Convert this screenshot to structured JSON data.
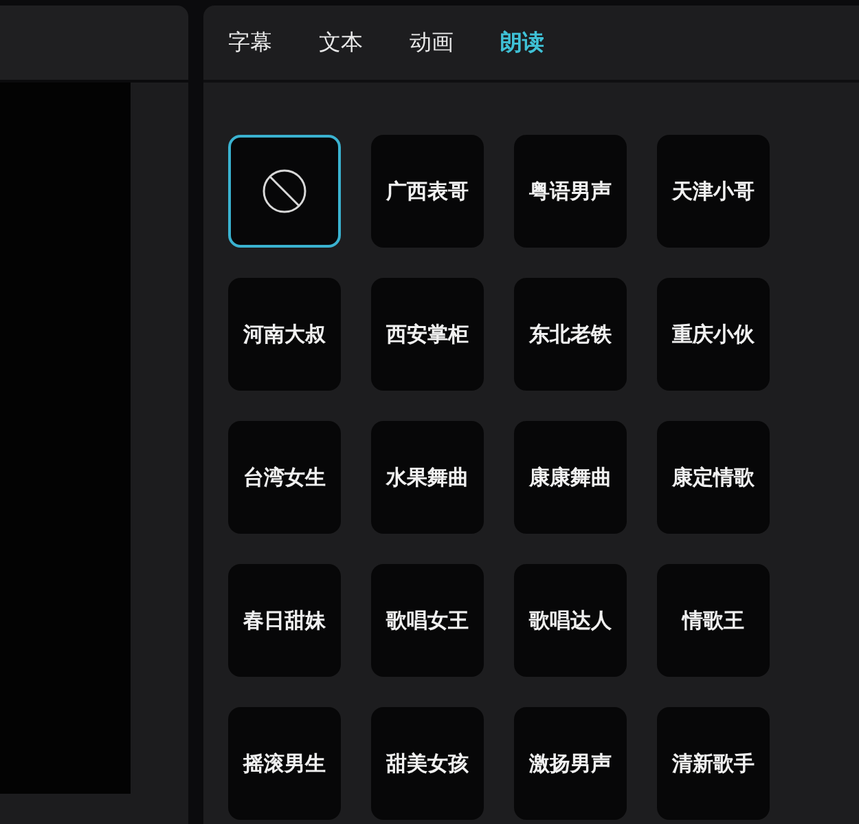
{
  "tabs": [
    {
      "label": "字幕",
      "selected": false
    },
    {
      "label": "文本",
      "selected": false
    },
    {
      "label": "动画",
      "selected": false
    },
    {
      "label": "朗读",
      "selected": true
    }
  ],
  "voices": [
    {
      "kind": "none",
      "selected": true
    },
    {
      "kind": "voice",
      "label": "广西表哥",
      "selected": false
    },
    {
      "kind": "voice",
      "label": "粤语男声",
      "selected": false
    },
    {
      "kind": "voice",
      "label": "天津小哥",
      "selected": false
    },
    {
      "kind": "voice",
      "label": "河南大叔",
      "selected": false
    },
    {
      "kind": "voice",
      "label": "西安掌柜",
      "selected": false
    },
    {
      "kind": "voice",
      "label": "东北老铁",
      "selected": false
    },
    {
      "kind": "voice",
      "label": "重庆小伙",
      "selected": false
    },
    {
      "kind": "voice",
      "label": "台湾女生",
      "selected": false
    },
    {
      "kind": "voice",
      "label": "水果舞曲",
      "selected": false
    },
    {
      "kind": "voice",
      "label": "康康舞曲",
      "selected": false
    },
    {
      "kind": "voice",
      "label": "康定情歌",
      "selected": false
    },
    {
      "kind": "voice",
      "label": "春日甜妹",
      "selected": false
    },
    {
      "kind": "voice",
      "label": "歌唱女王",
      "selected": false
    },
    {
      "kind": "voice",
      "label": "歌唱达人",
      "selected": false
    },
    {
      "kind": "voice",
      "label": "情歌王",
      "selected": false
    },
    {
      "kind": "voice",
      "label": "摇滚男生",
      "selected": false
    },
    {
      "kind": "voice",
      "label": "甜美女孩",
      "selected": false
    },
    {
      "kind": "voice",
      "label": "激扬男声",
      "selected": false
    },
    {
      "kind": "voice",
      "label": "清新歌手",
      "selected": false
    }
  ]
}
